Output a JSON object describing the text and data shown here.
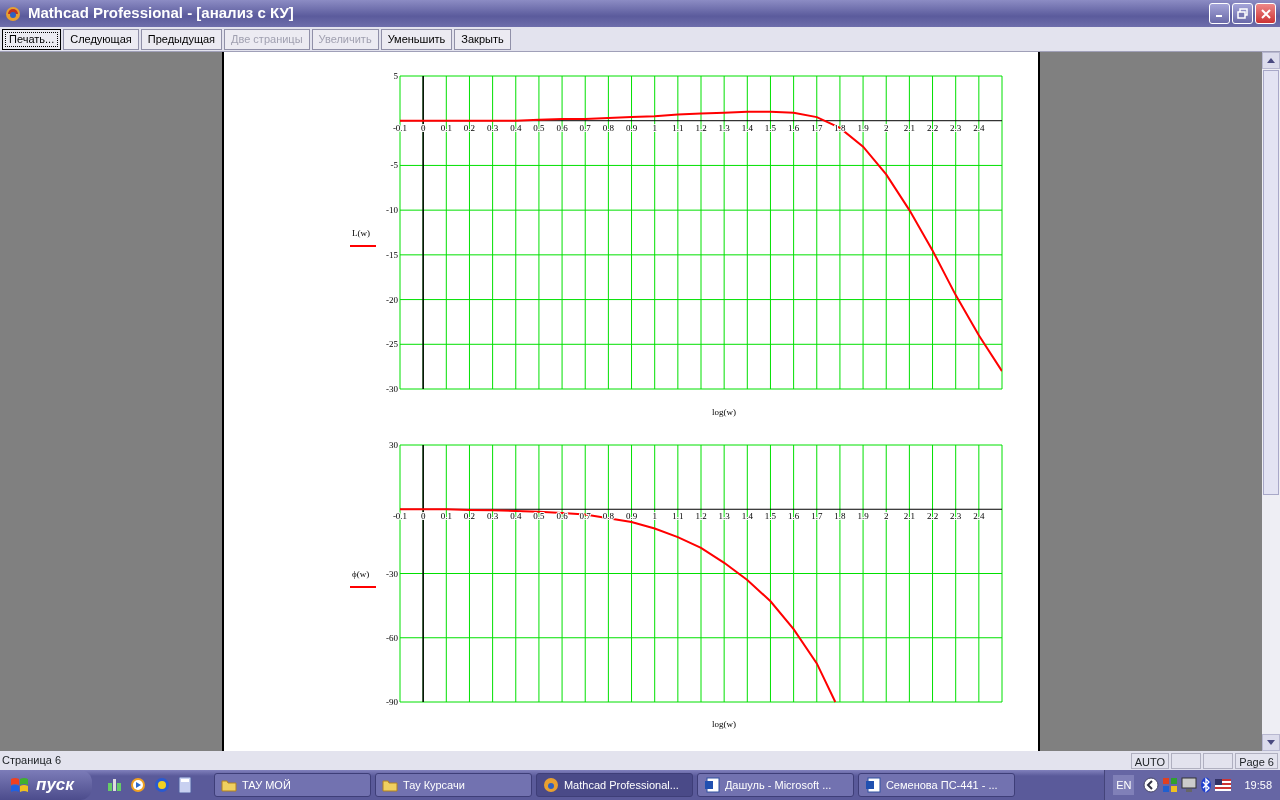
{
  "window": {
    "title": "Mathcad Professional - [анализ с КУ]"
  },
  "toolbar": [
    {
      "label": "Печать...",
      "selected": true,
      "disabled": false
    },
    {
      "label": "Следующая",
      "selected": false,
      "disabled": false
    },
    {
      "label": "Предыдущая",
      "selected": false,
      "disabled": false
    },
    {
      "label": "Две страницы",
      "selected": false,
      "disabled": true
    },
    {
      "label": "Увеличить",
      "selected": false,
      "disabled": true
    },
    {
      "label": "Уменьшить",
      "selected": false,
      "disabled": false
    },
    {
      "label": "Закрыть",
      "selected": false,
      "disabled": false
    }
  ],
  "plots": [
    {
      "chart_data": {
        "type": "line",
        "grid": true,
        "xlabel": "log(w)",
        "xlim": [
          -0.1,
          2.5
        ],
        "ylim": [
          -30,
          5
        ],
        "xticks": [
          -0.1,
          0,
          0.1,
          0.2,
          0.3,
          0.4,
          0.5,
          0.6,
          0.7,
          0.8,
          0.9,
          1,
          1.1,
          1.2,
          1.3,
          1.4,
          1.5,
          1.6,
          1.7,
          1.8,
          1.9,
          2,
          2.1,
          2.2,
          2.3,
          2.4
        ],
        "yticks": [
          5,
          -5,
          -10,
          -15,
          -20,
          -25,
          -30
        ],
        "x": [
          -0.1,
          0,
          0.1,
          0.2,
          0.3,
          0.4,
          0.5,
          0.6,
          0.7,
          0.8,
          0.9,
          1,
          1.1,
          1.2,
          1.3,
          1.4,
          1.5,
          1.6,
          1.7,
          1.8,
          1.9,
          2,
          2.1,
          2.2,
          2.3,
          2.4,
          2.5
        ],
        "series": [
          {
            "name": "L(w)",
            "color": "#ff0000",
            "values": [
              0,
              0,
              0,
              0,
              0,
              0,
              0.1,
              0.2,
              0.2,
              0.3,
              0.4,
              0.5,
              0.7,
              0.8,
              0.9,
              1,
              1,
              0.9,
              0.4,
              -0.8,
              -2.9,
              -6,
              -10,
              -14.5,
              -19.5,
              -24,
              -28
            ]
          }
        ]
      }
    },
    {
      "chart_data": {
        "type": "line",
        "grid": true,
        "xlabel": "log(w)",
        "xlim": [
          -0.1,
          2.5
        ],
        "ylim": [
          -90,
          30
        ],
        "xticks": [
          -0.1,
          0,
          0.1,
          0.2,
          0.3,
          0.4,
          0.5,
          0.6,
          0.7,
          0.8,
          0.9,
          1,
          1.1,
          1.2,
          1.3,
          1.4,
          1.5,
          1.6,
          1.7,
          1.8,
          1.9,
          2,
          2.1,
          2.2,
          2.3,
          2.4
        ],
        "yticks": [
          30,
          -30,
          -60,
          -90
        ],
        "x": [
          -0.1,
          0,
          0.1,
          0.2,
          0.3,
          0.4,
          0.5,
          0.6,
          0.7,
          0.9,
          1,
          1.1,
          1.2,
          1.3,
          1.4,
          1.5,
          1.6,
          1.7,
          1.78
        ],
        "series": [
          {
            "name": "ϕ(w)",
            "color": "#ff0000",
            "values": [
              0,
              0,
              0,
              -0.3,
              -0.5,
              -0.8,
              -1.2,
              -1.8,
              -2.5,
              -6,
              -9,
              -13,
              -18,
              -25,
              -33,
              -43,
              -56,
              -72,
              -90
            ]
          }
        ]
      }
    }
  ],
  "status_bar": {
    "page": "Страница 6",
    "cells": [
      "AUTO",
      "Page 6"
    ]
  },
  "taskbar": {
    "start": "пуск",
    "tasks": [
      {
        "label": "ТАУ МОЙ",
        "kind": "folder",
        "selected": false
      },
      {
        "label": "Тау Курсачи",
        "kind": "folder",
        "selected": false
      },
      {
        "label": "Mathcad Professional...",
        "kind": "mathcad",
        "selected": true
      },
      {
        "label": "Дашуль - Microsoft ...",
        "kind": "word",
        "selected": false
      },
      {
        "label": "Семенова ПС-441 - ...",
        "kind": "word",
        "selected": false
      }
    ],
    "language": "EN",
    "clock": "19:58"
  }
}
